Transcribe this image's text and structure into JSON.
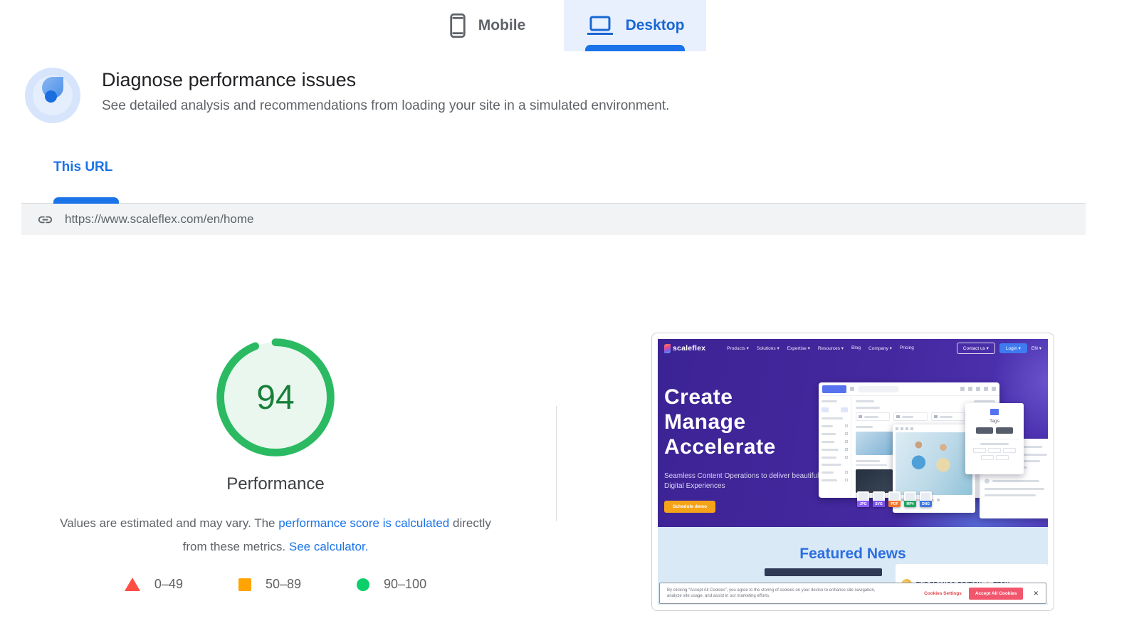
{
  "device_tabs": {
    "mobile_label": "Mobile",
    "desktop_label": "Desktop"
  },
  "header": {
    "title": "Diagnose performance issues",
    "subtitle": "See detailed analysis and recommendations from loading your site in a simulated environment."
  },
  "url_section": {
    "tab_label": "This URL",
    "url": "https://www.scaleflex.com/en/home"
  },
  "score": {
    "value": "94",
    "label": "Performance"
  },
  "disclaimer": {
    "text_before": "Values are estimated and may vary. The ",
    "link_calculated": "performance score is calculated",
    "text_middle": " directly from these metrics. ",
    "link_calculator": "See calculator."
  },
  "legend": {
    "items": [
      {
        "range": "0–49",
        "color": "#ff4e42",
        "shape": "triangle"
      },
      {
        "range": "50–89",
        "color": "#ffa400",
        "shape": "square"
      },
      {
        "range": "90–100",
        "color": "#0cce6b",
        "shape": "circle"
      }
    ]
  },
  "colors": {
    "accent_blue": "#1a73e8",
    "tab_active_bg": "#e8f0fe",
    "score_ring_green": "#2bba62",
    "score_fill_green": "#e9f7ef",
    "score_number_green": "#188038"
  },
  "preview": {
    "brand": "scaleflex",
    "nav": [
      "Products ▾",
      "Solutions ▾",
      "Expertise ▾",
      "Resources ▾",
      "Blog",
      "Company ▾",
      "Pricing"
    ],
    "contact_button": "Contact us ▾",
    "login_button": "Login ▾",
    "lang": "EN ▾",
    "hero_lines": [
      "Create",
      "Manage",
      "Accelerate"
    ],
    "tagline_line1": "Seamless Content Operations to deliver beautiful",
    "tagline_line2": "Digital Experiences",
    "cta": "Schedule demo",
    "tags_panel_label": "Tags",
    "file_icons": [
      {
        "label": "JPG"
      },
      {
        "label": "SVG"
      },
      {
        "label": "PDF"
      },
      {
        "label": "MP4"
      },
      {
        "label": "DNG"
      }
    ],
    "more_dots": "…",
    "featured_title": "Featured News",
    "news_text_1": "THE FRANCO-BRITISH",
    "news_text_2": "TECH",
    "cookie": {
      "line1": "By clicking “Accept All Cookies”, you agree to the storing of cookies on your device to enhance site navigation,",
      "line2": "analyze site usage, and assist in our marketing efforts.",
      "settings": "Cookies Settings",
      "accept": "Accept All Cookies",
      "close": "✕"
    }
  }
}
